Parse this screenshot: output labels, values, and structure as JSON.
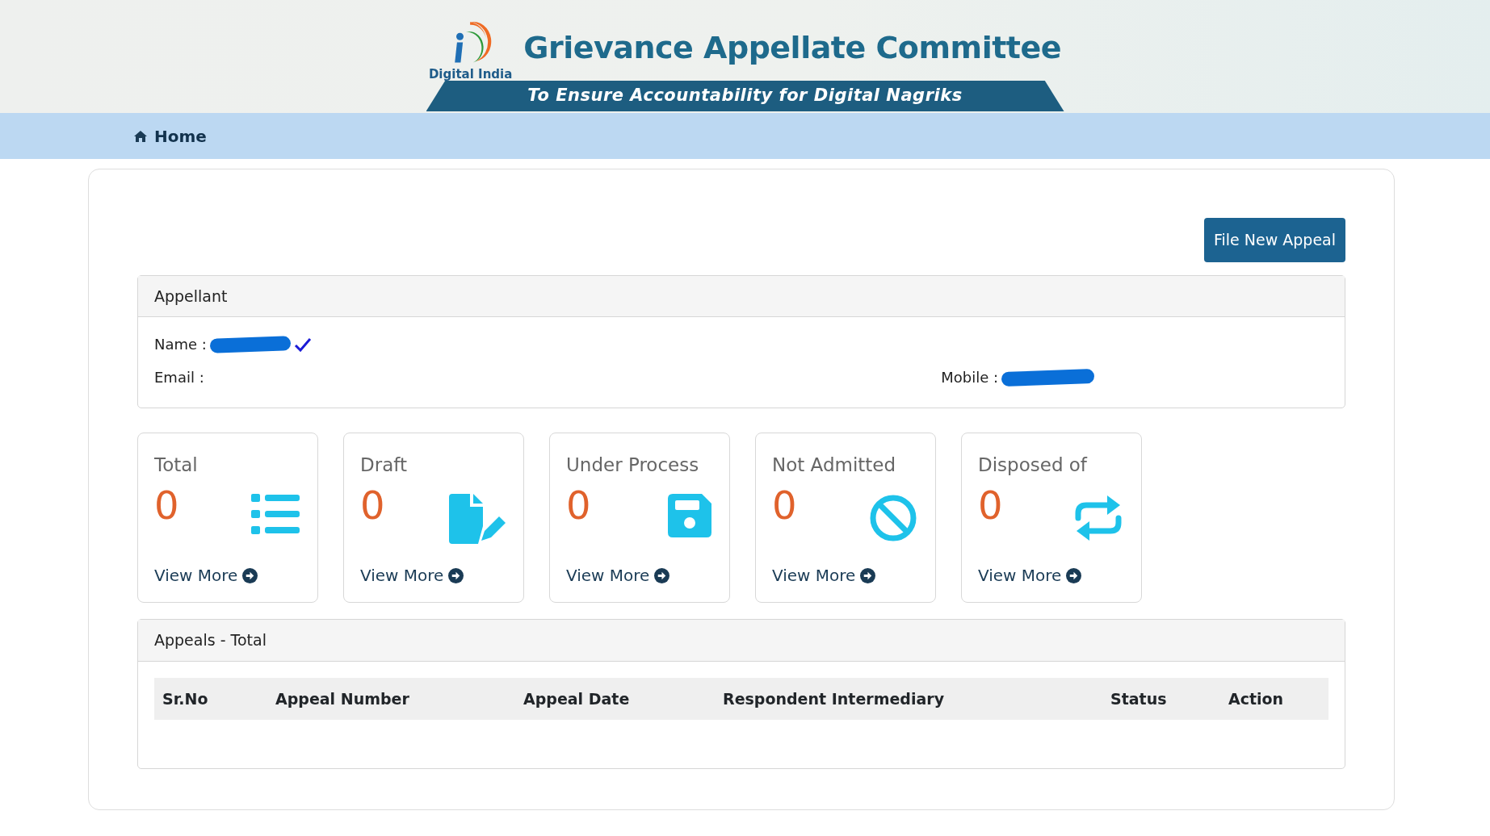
{
  "header": {
    "logo_caption": "Digital India",
    "title": "Grievance Appellate Committee",
    "tagline": "To Ensure Accountability for Digital Nagriks"
  },
  "nav": {
    "items": [
      {
        "label": "Home",
        "selected": true
      }
    ]
  },
  "actions": {
    "primary_button": "File New Appeal"
  },
  "appellant": {
    "heading": "Appellant",
    "name_label": "Name :",
    "name_redacted": true,
    "verified": true,
    "email_label": "Email :",
    "mobile_label": "Mobile :",
    "mobile_redacted": true
  },
  "stats": [
    {
      "label": "Total",
      "count": "0",
      "kind": "list",
      "link": "View More"
    },
    {
      "label": "Draft",
      "count": "0",
      "kind": "edit",
      "link": "View More"
    },
    {
      "label": "Under Process",
      "count": "0",
      "kind": "save",
      "link": "View More"
    },
    {
      "label": "Not Admitted",
      "count": "0",
      "kind": "ban",
      "link": "View More"
    },
    {
      "label": "Disposed of",
      "count": "0",
      "kind": "repeat",
      "link": "View More"
    }
  ],
  "appeals": {
    "heading": "Appeals - Total",
    "table": {
      "columns": [
        "Sr.No",
        "Appeal Number",
        "Appeal Date",
        "Respondent Intermediary",
        "Status",
        "Action"
      ]
    }
  }
}
